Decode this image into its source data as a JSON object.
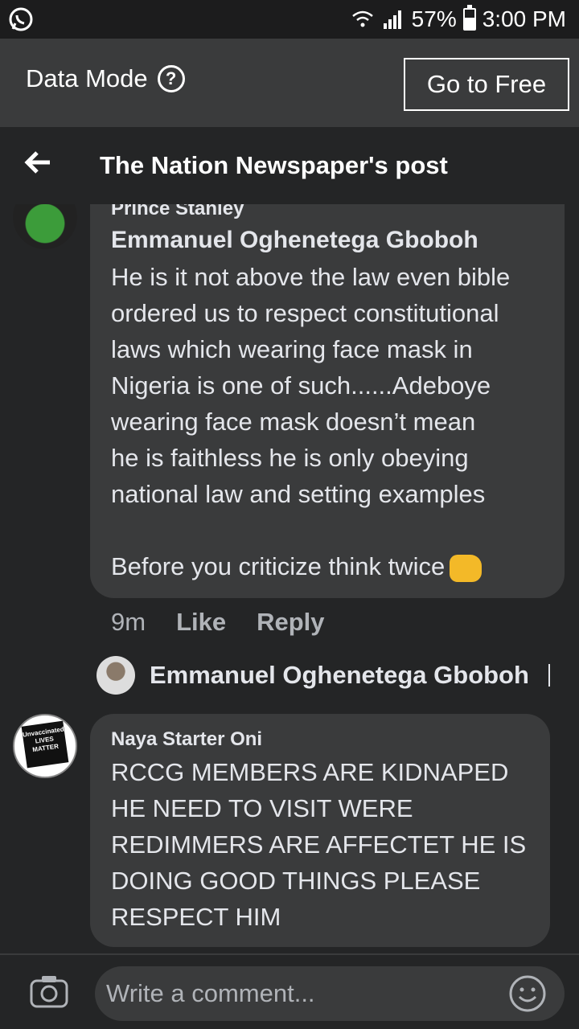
{
  "status_bar": {
    "battery": "57%",
    "battery_level": 0.57,
    "time": "3:00 PM"
  },
  "data_bar": {
    "label": "Data Mode",
    "help_symbol": "?",
    "button_label": "Go to Free"
  },
  "header": {
    "title": "The Nation Newspaper's post"
  },
  "comments": [
    {
      "quoted_name": "Prince Stanley",
      "author": "Emmanuel Oghenetega Gboboh",
      "lines": [
        "He is it not above the law even bible",
        "ordered us to respect constitutional",
        "laws which wearing face mask in",
        "Nigeria is one of such......Adeboye",
        "wearing face mask doesn’t mean",
        "he is faithless he is only obeying",
        "national law and setting examples",
        "",
        "Before you criticize  think twice"
      ],
      "time": "9m",
      "like_label": "Like",
      "reply_label": "Reply"
    },
    {
      "author": "Naya Starter Oni",
      "lines": [
        "RCCG MEMBERS ARE KIDNAPED",
        "HE NEED TO VISIT WERE",
        "REDIMMERS ARE AFFECTET HE IS",
        "DOING GOOD THINGS PLEASE",
        "RESPECT HIM"
      ]
    }
  ],
  "reply_box": {
    "author": "Emmanuel Oghenetega Gboboh"
  },
  "comment_input": {
    "placeholder": "Write a comment..."
  },
  "avatar_badge": {
    "text": "Unvaccinated LIVES MATTER"
  },
  "colors": {
    "background": "#242526",
    "bubble": "#3a3b3c",
    "text": "#e4e6eb",
    "muted": "#b0b3b8"
  }
}
